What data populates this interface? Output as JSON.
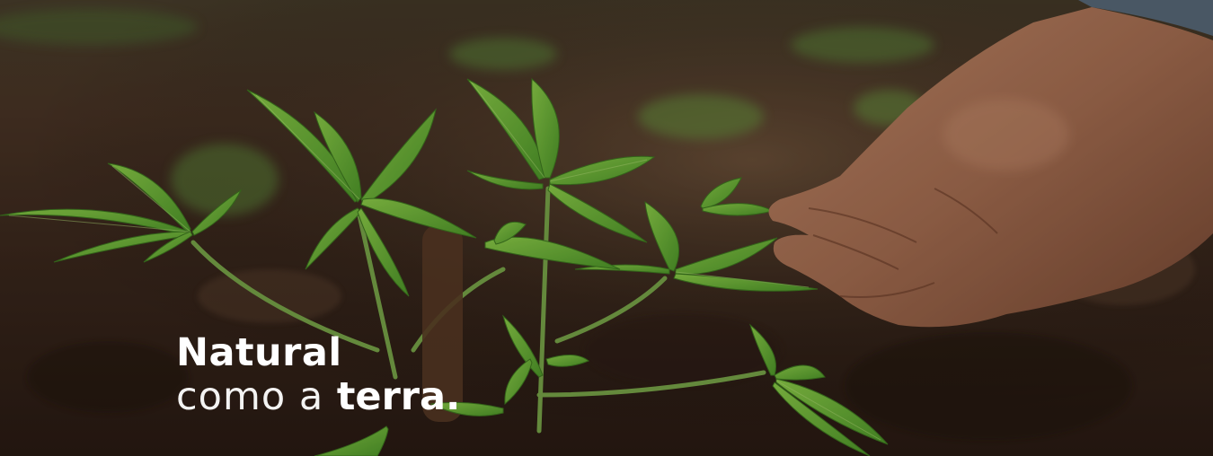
{
  "hero": {
    "headline_line1": "Natural",
    "headline_line2_light": "como a ",
    "headline_line2_bold": "terra."
  },
  "colors": {
    "text": "#ffffff",
    "soil": "#3b2a20",
    "leaf": "#6fb23a"
  }
}
